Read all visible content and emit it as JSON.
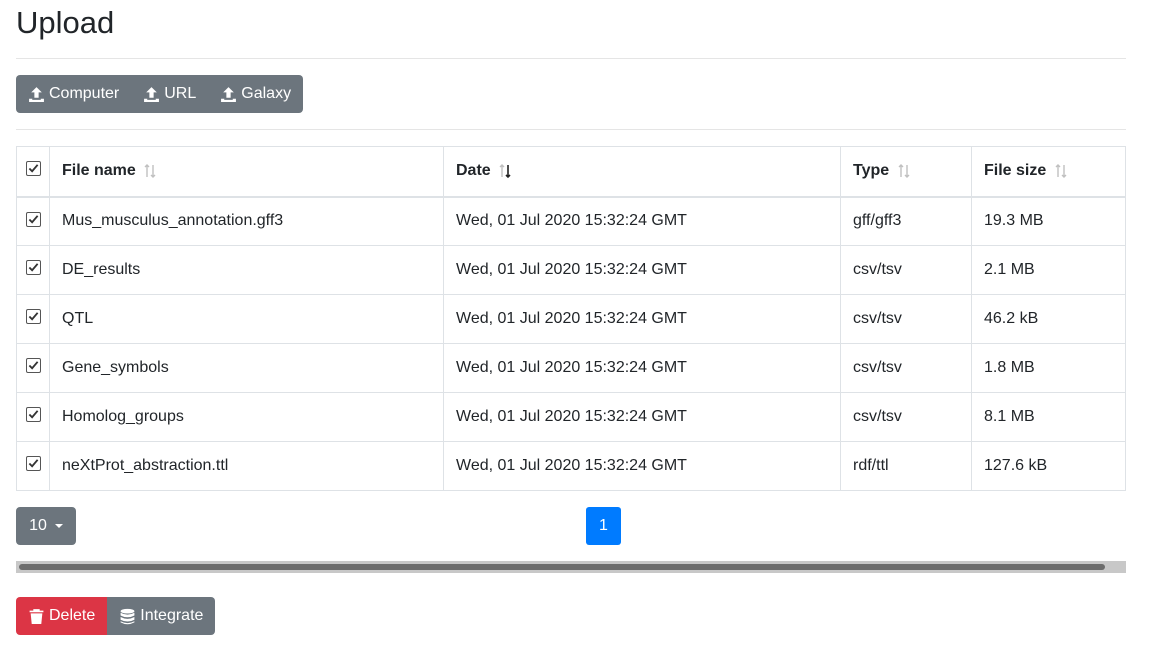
{
  "page": {
    "title": "Upload"
  },
  "upload_buttons": {
    "computer": "Computer",
    "url": "URL",
    "galaxy": "Galaxy"
  },
  "table": {
    "headers": {
      "file_name": "File name",
      "date": "Date",
      "type": "Type",
      "file_size": "File size"
    },
    "sorted_column": "date",
    "rows": [
      {
        "checked": true,
        "name": "Mus_musculus_annotation.gff3",
        "date": "Wed, 01 Jul 2020 15:32:24 GMT",
        "type": "gff/gff3",
        "size": "19.3 MB"
      },
      {
        "checked": true,
        "name": "DE_results",
        "date": "Wed, 01 Jul 2020 15:32:24 GMT",
        "type": "csv/tsv",
        "size": "2.1 MB"
      },
      {
        "checked": true,
        "name": "QTL",
        "date": "Wed, 01 Jul 2020 15:32:24 GMT",
        "type": "csv/tsv",
        "size": "46.2 kB"
      },
      {
        "checked": true,
        "name": "Gene_symbols",
        "date": "Wed, 01 Jul 2020 15:32:24 GMT",
        "type": "csv/tsv",
        "size": "1.8 MB"
      },
      {
        "checked": true,
        "name": "Homolog_groups",
        "date": "Wed, 01 Jul 2020 15:32:24 GMT",
        "type": "csv/tsv",
        "size": "8.1 MB"
      },
      {
        "checked": true,
        "name": "neXtProt_abstraction.ttl",
        "date": "Wed, 01 Jul 2020 15:32:24 GMT",
        "type": "rdf/ttl",
        "size": "127.6 kB"
      }
    ]
  },
  "pagination": {
    "page_size": "10",
    "current_page": "1"
  },
  "actions": {
    "delete": "Delete",
    "integrate": "Integrate"
  },
  "icons": {
    "upload": "upload-icon",
    "trash": "trash-icon",
    "database": "database-icon",
    "sort": "sort-icon"
  },
  "colors": {
    "secondary": "#6c757d",
    "primary": "#007bff",
    "danger": "#dc3545"
  }
}
